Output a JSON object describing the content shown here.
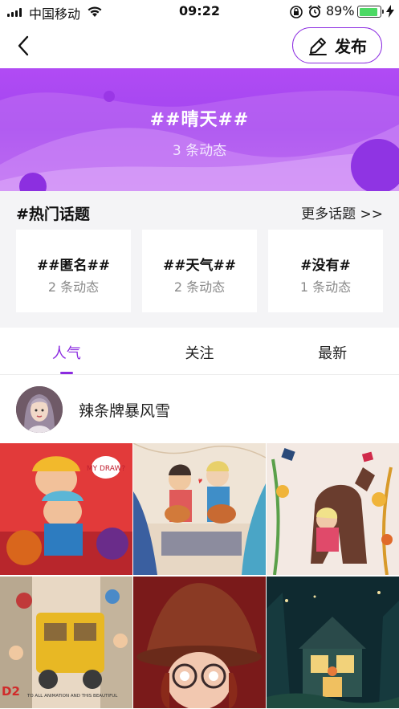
{
  "status_bar": {
    "carrier": "中国移动",
    "time": "09:22",
    "battery_percent": "89%",
    "battery_level": 0.89
  },
  "nav": {
    "publish_label": "发布"
  },
  "hero": {
    "title": "##晴天##",
    "count": "3 条动态"
  },
  "hot_topics": {
    "title": "#热门话题",
    "more_label": "更多话题 >>",
    "items": [
      {
        "name": "##匿名##",
        "count": "2 条动态"
      },
      {
        "name": "##天气##",
        "count": "2 条动态"
      },
      {
        "name": "#没有#",
        "count": "1 条动态"
      }
    ]
  },
  "tabs": [
    {
      "label": "人气",
      "active": true
    },
    {
      "label": "关注",
      "active": false
    },
    {
      "label": "最新",
      "active": false
    }
  ],
  "post": {
    "username": "辣条牌暴风雪"
  },
  "gallery": {
    "images": [
      {
        "label": "MY DRAW?"
      },
      {
        "label": ""
      },
      {
        "label": ""
      },
      {
        "label": "TO ALL ANIMATION AND THIS BEAUTIFUL"
      },
      {
        "label": ""
      },
      {
        "label": ""
      }
    ]
  },
  "colors": {
    "accent": "#8b2be0",
    "hero_gradient_top": "#b14bf4",
    "section_bg": "#f4f4f6"
  },
  "icons": [
    "back-arrow-icon",
    "pencil-icon",
    "wifi-icon",
    "lock-rotation-icon",
    "alarm-icon",
    "charging-icon"
  ]
}
